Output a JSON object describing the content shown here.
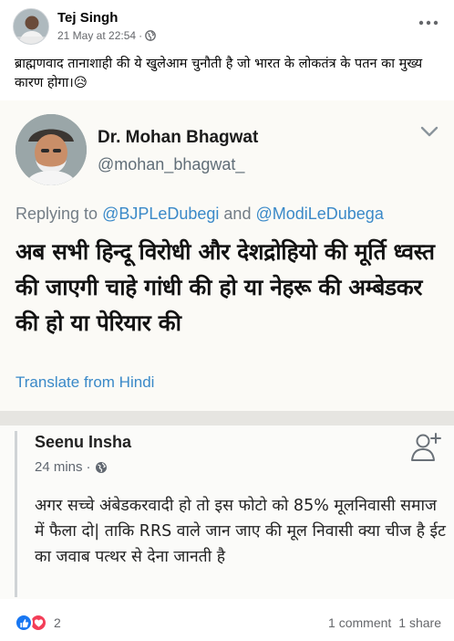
{
  "post": {
    "author": "Tej Singh",
    "timestamp": "21 May at 22:54",
    "separator": "·",
    "audience_icon": "globe-icon",
    "caption": "ब्राह्मणवाद तानाशाही की ये खुलेआम चुनौती है जो भारत के लोकतंत्र के पतन का मुख्य कारण होगा।😥"
  },
  "tweet": {
    "name": "Dr. Mohan Bhagwat",
    "handle": "@mohan_bhagwat_",
    "replying_prefix": "Replying to ",
    "mention1": "@BJPLeDubegi",
    "and": " and ",
    "mention2": "@ModiLeDubega",
    "body": "अब सभी हिन्दू विरोधी और देशद्रोहियो की मूर्ति ध्वस्त की जाएगी चाहे गांधी की हो या नेहरू की अम्बेडकर की हो या पेरियार की",
    "translate": "Translate from Hindi"
  },
  "comment": {
    "name": "Seenu Insha",
    "time": "24 mins",
    "separator": "·",
    "body": "अगर सच्चे अंबेडकरवादी हो तो इस फोटो को 85% मूलनिवासी समाज में फैला दो| ताकि RRS वाले जान जाए की मूल निवासी क्या चीज है ईट का जवाब पत्थर से देना जानती है"
  },
  "footer": {
    "reaction_count": "2",
    "comments": "1 comment",
    "shares": "1 share"
  },
  "colors": {
    "twitter_blue": "#3a89c8",
    "like_blue": "#1877f2",
    "love_red": "#f33e58",
    "meta_gray": "#65676b"
  }
}
